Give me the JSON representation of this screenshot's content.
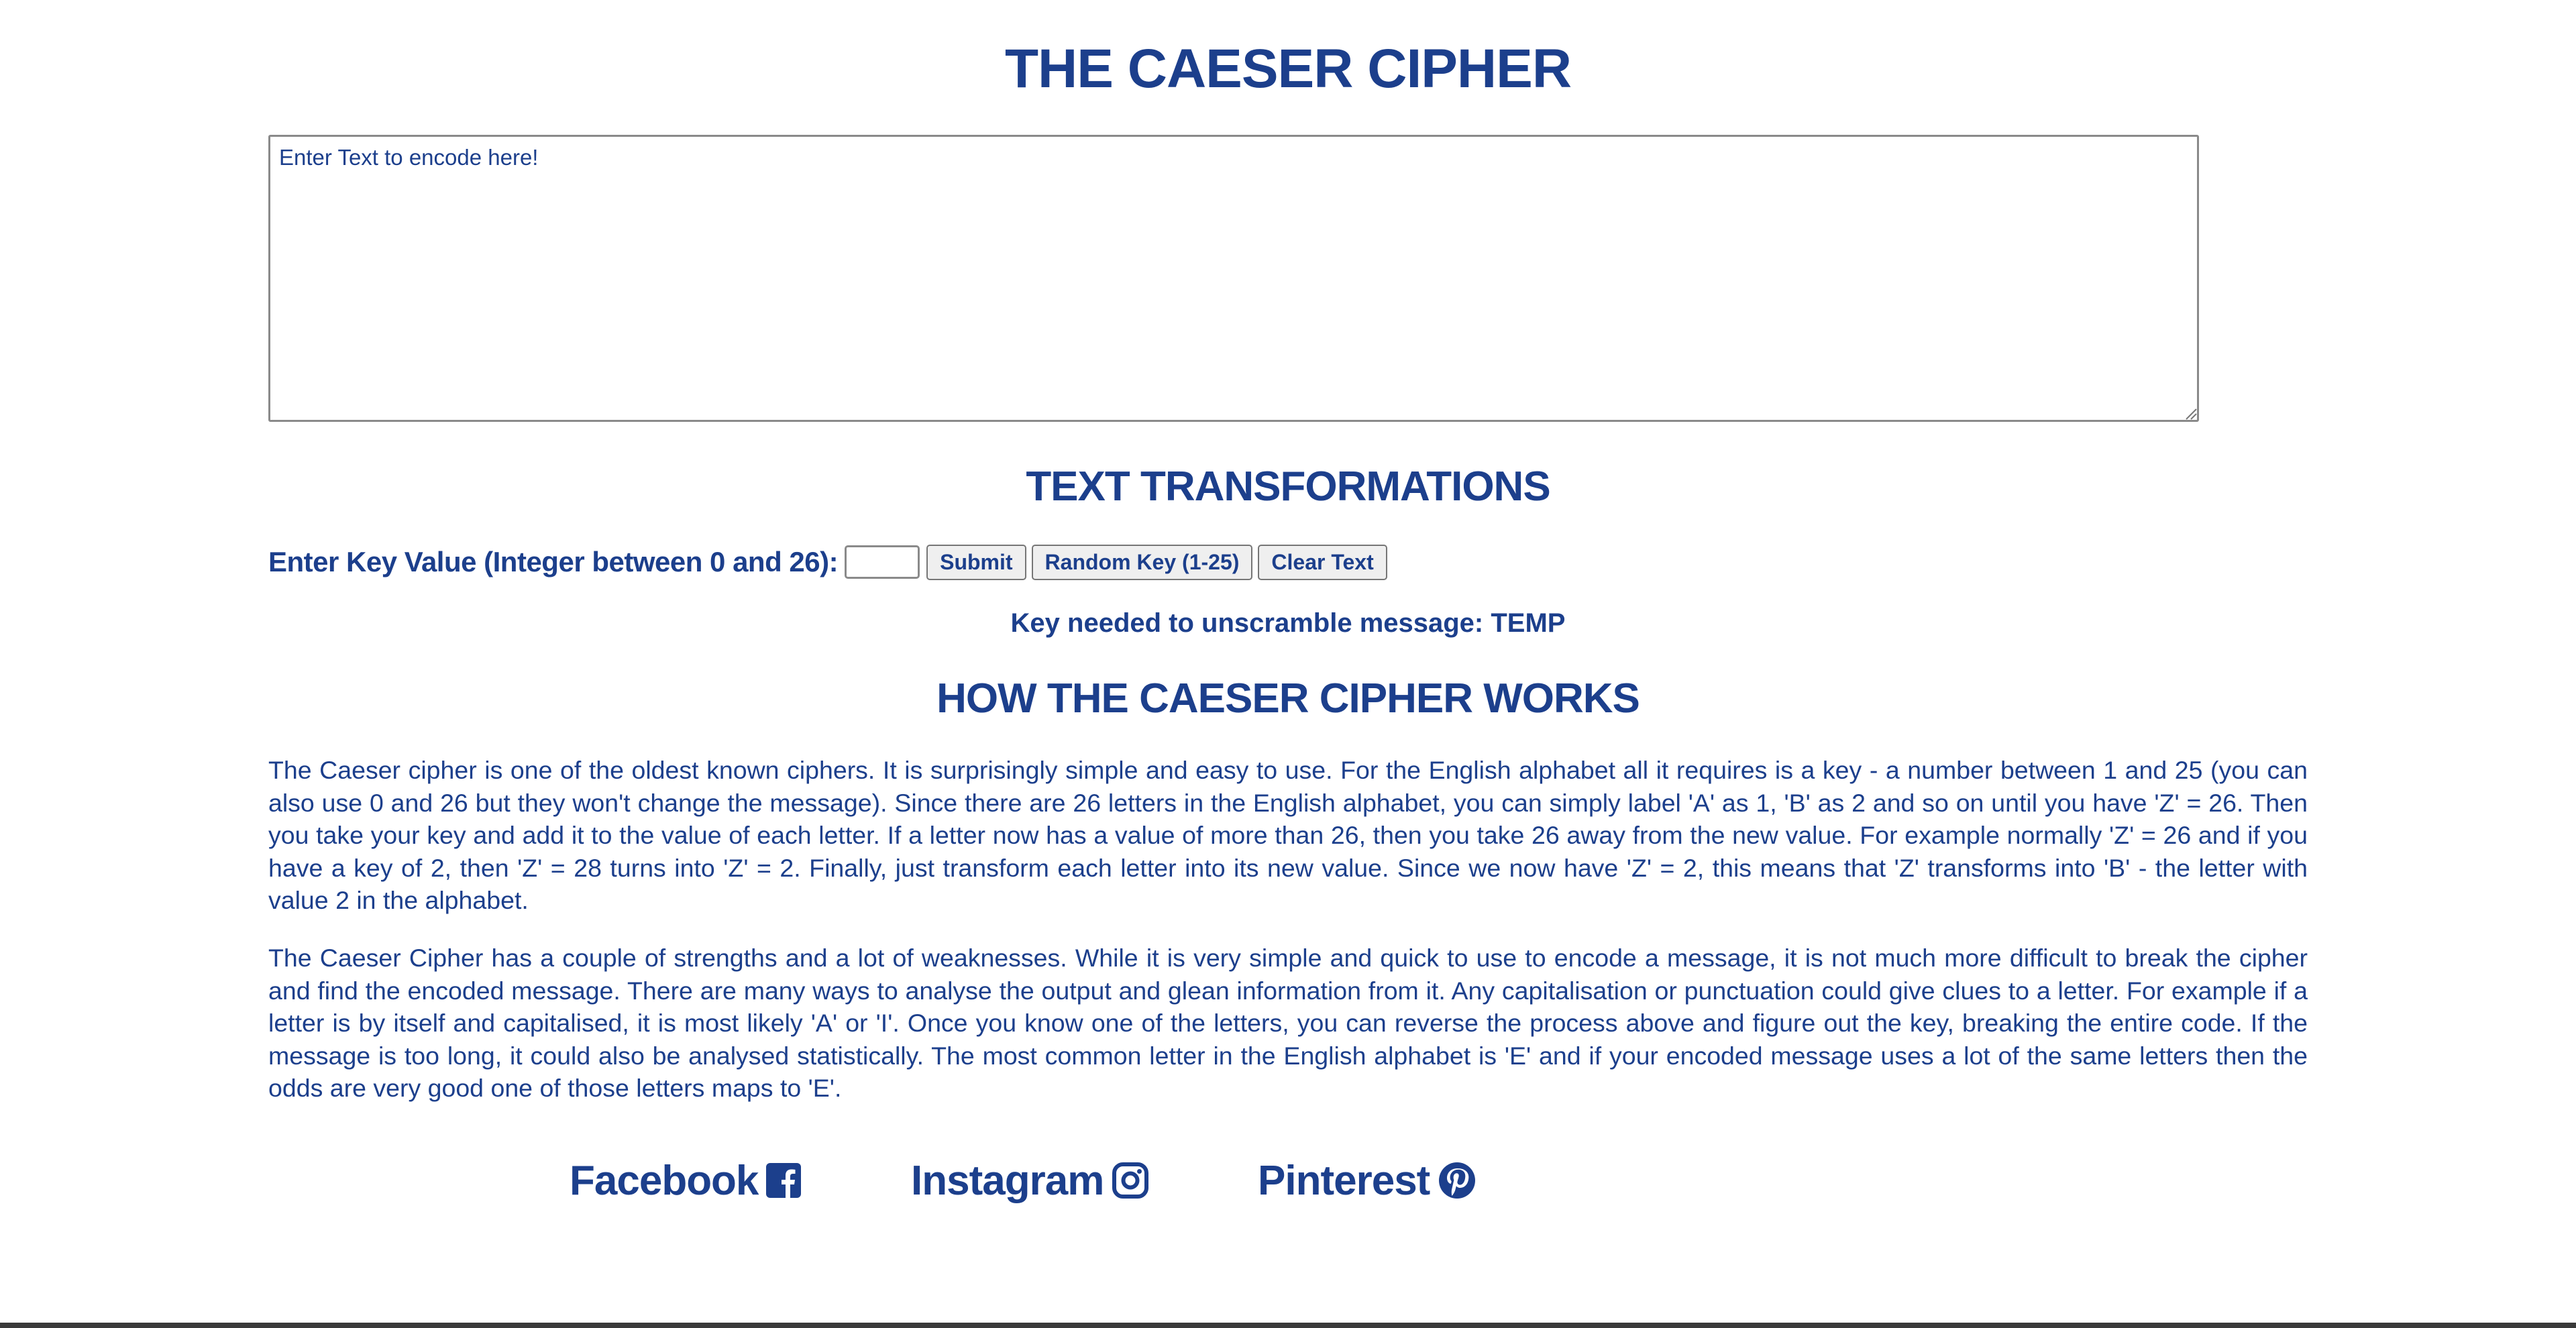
{
  "header": {
    "title": "THE CAESER CIPHER"
  },
  "input": {
    "placeholder": "Enter Text to encode here!",
    "value": ""
  },
  "transformations": {
    "heading": "TEXT TRANSFORMATIONS",
    "key_label": "Enter Key Value (Integer between 0 and 26):",
    "key_value": "",
    "submit_label": "Submit",
    "random_label": "Random Key (1-25)",
    "clear_label": "Clear Text",
    "key_needed": "Key needed to unscramble message: TEMP"
  },
  "how": {
    "heading": "HOW THE CAESER CIPHER WORKS",
    "paragraphs": [
      "The Caeser cipher is one of the oldest known ciphers. It is surprisingly simple and easy to use. For the English alphabet all it requires is a key - a number between 1 and 25 (you can also use 0 and 26 but they won't change the message). Since there are 26 letters in the English alphabet, you can simply label 'A' as 1, 'B' as 2 and so on until you have 'Z' = 26. Then you take your key and add it to the value of each letter. If a letter now has a value of more than 26, then you take 26 away from the new value. For example normally 'Z' = 26 and if you have a key of 2, then 'Z' = 28 turns into 'Z' = 2. Finally, just transform each letter into its new value. Since we now have 'Z' = 2, this means that 'Z' transforms into 'B' - the letter with value 2 in the alphabet.",
      "The Caeser Cipher has a couple of strengths and a lot of weaknesses. While it is very simple and quick to use to encode a message, it is not much more difficult to break the cipher and find the encoded message. There are many ways to analyse the output and glean information from it. Any capitalisation or punctuation could give clues to a letter. For example if a letter is by itself and capitalised, it is most likely 'A' or 'I'. Once you know one of the letters, you can reverse the process above and figure out the key, breaking the entire code. If the message is too long, it could also be analysed statistically. The most common letter in the English alphabet is 'E' and if your encoded message uses a lot of the same letters then the odds are very good one of those letters maps to 'E'."
    ]
  },
  "social": [
    {
      "label": "Facebook",
      "icon": "facebook-square-icon"
    },
    {
      "label": "Instagram",
      "icon": "instagram-icon"
    },
    {
      "label": "Pinterest",
      "icon": "pinterest-icon"
    }
  ],
  "colors": {
    "text": "#1c3f8c",
    "background": "#ffffff",
    "button_bg": "#efefef",
    "border": "#8a8a8a"
  }
}
